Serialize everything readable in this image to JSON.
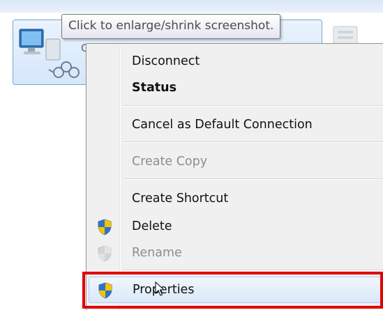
{
  "tooltip": {
    "text": "Click to enlarge/shrink screenshot."
  },
  "connection": {
    "icon": "network-connection-icon",
    "partial_label_letter": "С"
  },
  "context_menu": {
    "items": {
      "disconnect": "Disconnect",
      "status": "Status",
      "cancel_default": "Cancel as Default Connection",
      "create_copy": "Create Copy",
      "create_shortcut": "Create Shortcut",
      "delete": "Delete",
      "rename": "Rename",
      "properties": "Properties"
    },
    "shield_icon": "uac-shield-icon",
    "highlight_color": "#e00000"
  }
}
